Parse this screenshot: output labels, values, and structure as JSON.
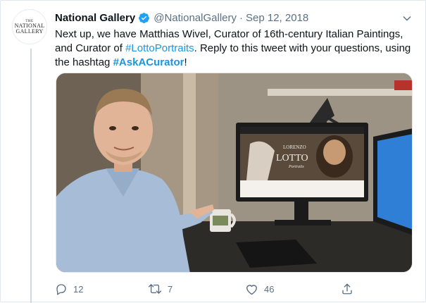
{
  "tweet": {
    "display_name": "National Gallery",
    "handle": "@NationalGallery",
    "separator": "·",
    "date": "Sep 12, 2018",
    "avatar_text": {
      "line1": "THE",
      "line2": "NATIONAL",
      "line3": "GALLERY"
    },
    "text_parts": {
      "p1": "Next up, we have Matthias Wivel, Curator of 16th-century Italian Paintings, and Curator of ",
      "hashtag1": "#LottoPortraits",
      "p2": ". Reply to this tweet with your questions, using the hashtag ",
      "hashtag2": "#AskACurator",
      "p3": "!"
    },
    "media": {
      "screen_title_small": "LORENZO",
      "screen_title_large": "LOTTO",
      "screen_subtitle": "Portraits"
    },
    "actions": {
      "replies": "12",
      "retweets": "7",
      "likes": "46"
    }
  },
  "colors": {
    "link": "#1b95e0",
    "meta": "#5b7083",
    "verified": "#1da1f2",
    "border": "#e1e8ed"
  },
  "icons": [
    "verified-badge-icon",
    "chevron-down-icon",
    "reply-icon",
    "retweet-icon",
    "like-icon",
    "share-icon"
  ]
}
